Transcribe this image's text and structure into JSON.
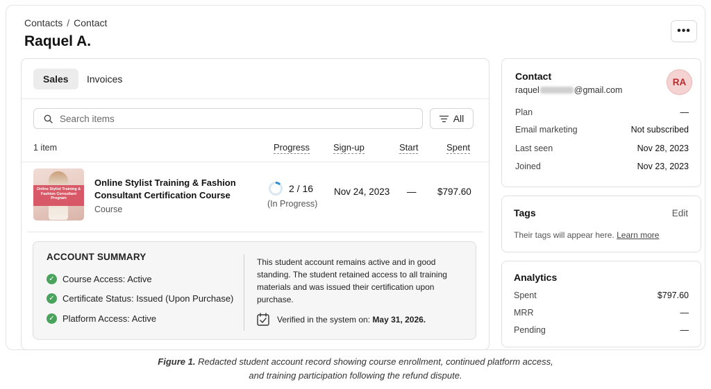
{
  "breadcrumb": {
    "parent": "Contacts",
    "separator": "/",
    "current": "Contact"
  },
  "page_title": "Raquel A.",
  "more_button": "•••",
  "tabs": [
    {
      "label": "Sales"
    },
    {
      "label": "Invoices"
    }
  ],
  "search": {
    "placeholder": "Search items"
  },
  "filter": {
    "label": "All"
  },
  "table": {
    "count": "1 item",
    "columns": {
      "progress": "Progress",
      "signup": "Sign-up",
      "start": "Start",
      "spent": "Spent"
    },
    "rows": [
      {
        "thumbnail_text": "Online Stylist Training & Fashion Consultant Program",
        "title": "Online Stylist Training & Fashion Consultant Certification Course",
        "type": "Course",
        "progress": "2 / 16",
        "progress_fraction": 0.125,
        "progress_status": "(In Progress)",
        "signup": "Nov 24, 2023",
        "start": "—",
        "spent": "$797.60"
      }
    ]
  },
  "summary": {
    "title": "ACCOUNT SUMMARY",
    "items": [
      "Course Access: Active",
      "Certificate Status: Issued (Upon Purchase)",
      "Platform Access: Active"
    ],
    "text": "This student account remains active and in good standing. The student retained access to all training materials and was issued their certification upon purchase.",
    "verified_label": "Verified in the system on:",
    "verified_date": "May 31, 2026."
  },
  "contact": {
    "heading": "Contact",
    "email_prefix": "raquel",
    "email_suffix": "@gmail.com",
    "avatar": "RA",
    "fields": [
      {
        "label": "Plan",
        "value": "—"
      },
      {
        "label": "Email marketing",
        "value": "Not subscribed"
      },
      {
        "label": "Last seen",
        "value": "Nov 28, 2023"
      },
      {
        "label": "Joined",
        "value": "Nov 23, 2023"
      }
    ]
  },
  "tags": {
    "heading": "Tags",
    "edit": "Edit",
    "empty": "Their tags will appear here.",
    "learn_more": "Learn more"
  },
  "analytics": {
    "heading": "Analytics",
    "fields": [
      {
        "label": "Spent",
        "value": "$797.60"
      },
      {
        "label": "MRR",
        "value": "—"
      },
      {
        "label": "Pending",
        "value": "—"
      }
    ]
  },
  "caption": {
    "label": "Figure 1.",
    "line1": "Redacted student account record showing course enrollment, continued platform access,",
    "line2": "and training participation following the refund dispute."
  },
  "colors": {
    "accent_blue": "#2a8fd6",
    "check_green": "#4aa35c",
    "avatar_red": "#b72c2c"
  }
}
